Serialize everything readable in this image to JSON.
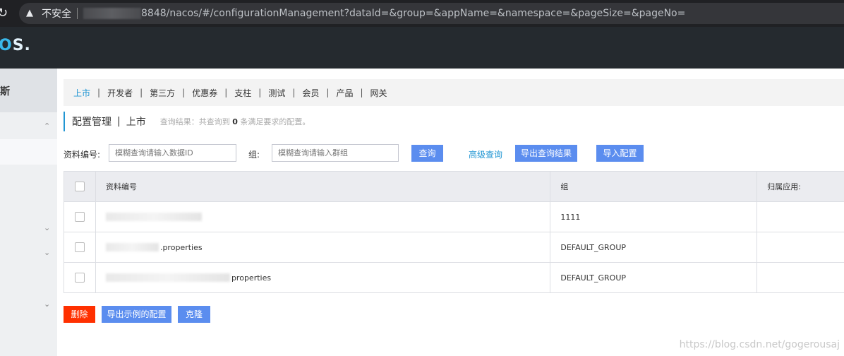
{
  "browser": {
    "security_label": "不安全",
    "url": "8848/nacos/#/configurationManagement?dataId=&group=&appName=&namespace=&pageSize=&pageNo="
  },
  "header": {
    "logo_text_pre": "O",
    "logo_text_post": "S."
  },
  "sidebar": {
    "title": "斯"
  },
  "namespaces": [
    "上市",
    "开发者",
    "第三方",
    "优惠券",
    "支柱",
    "测试",
    "会员",
    "产品",
    "网关"
  ],
  "page": {
    "title": "配置管理",
    "divider": "|",
    "namespace": "上市",
    "result_pre": "查询结果：共查询到",
    "result_count": "0",
    "result_post": "条满足要求的配置。"
  },
  "filters": {
    "data_id_label": "资料编号:",
    "data_id_placeholder": "模糊查询请输入数据ID",
    "group_label": "组:",
    "group_placeholder": "模糊查询请输入群组",
    "search_label": "查询",
    "advanced_label": "高级查询",
    "export_label": "导出查询结果",
    "import_label": "导入配置"
  },
  "table": {
    "headers": [
      "资料编号",
      "组",
      "归属应用:"
    ],
    "rows": [
      {
        "data_id": "",
        "group": "1111",
        "app": ""
      },
      {
        "data_id": ".properties",
        "group": "DEFAULT_GROUP",
        "app": ""
      },
      {
        "data_id": "properties",
        "group": "DEFAULT_GROUP",
        "app": ""
      }
    ]
  },
  "actions": {
    "delete_label": "删除",
    "export_selected_label": "导出示例的配置",
    "clone_label": "克隆"
  },
  "watermark": "https://blog.csdn.net/gogerousaj"
}
